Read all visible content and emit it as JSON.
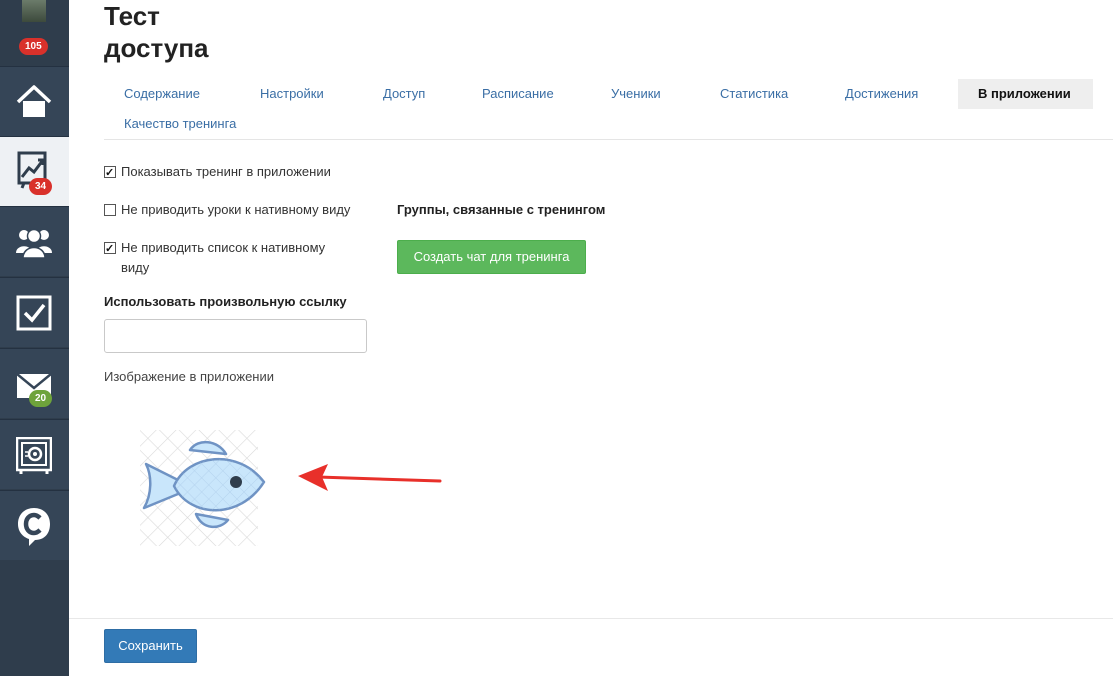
{
  "sidebar": {
    "profile_badge": "105",
    "items": [
      {
        "icon": "home-icon"
      },
      {
        "icon": "chart-trend-icon",
        "badge": "34",
        "active": true
      },
      {
        "icon": "users-icon"
      },
      {
        "icon": "checkbox-icon"
      },
      {
        "icon": "mail-icon",
        "badge": "20"
      },
      {
        "icon": "safe-icon"
      },
      {
        "icon": "chat-c-icon"
      }
    ]
  },
  "page": {
    "title_line1": "Тест",
    "title_line2": "доступа"
  },
  "tabs": [
    {
      "label": "Содержание"
    },
    {
      "label": "Настройки"
    },
    {
      "label": "Доступ"
    },
    {
      "label": "Расписание"
    },
    {
      "label": "Ученики"
    },
    {
      "label": "Статистика"
    },
    {
      "label": "Достижения"
    },
    {
      "label": "В приложении",
      "active": true
    },
    {
      "label": "Качество тренинга"
    }
  ],
  "settings": {
    "show_in_app": {
      "label": "Показывать тренинг в приложении",
      "checked": true
    },
    "no_native_lessons": {
      "label": "Не приводить уроки к нативному виду",
      "checked": false
    },
    "no_native_list": {
      "label_line1": "Не приводить список к нативному",
      "label_line2": "виду",
      "checked": true
    },
    "custom_link_label": "Использовать произвольную ссылку",
    "custom_link_value": "",
    "app_image_label": "Изображение в приложении"
  },
  "groups": {
    "title": "Группы, связанные с тренингом",
    "create_chat_label": "Создать чат для тренинга"
  },
  "footer": {
    "save_label": "Сохранить"
  },
  "colors": {
    "sidebar_bg": "#2f3d4c",
    "link": "#3a6ea5",
    "green_button": "#5cb85c",
    "save_button": "#337ab7",
    "badge_red": "#d9312b",
    "badge_green": "#6ea33b",
    "arrow": "#e8302a"
  }
}
